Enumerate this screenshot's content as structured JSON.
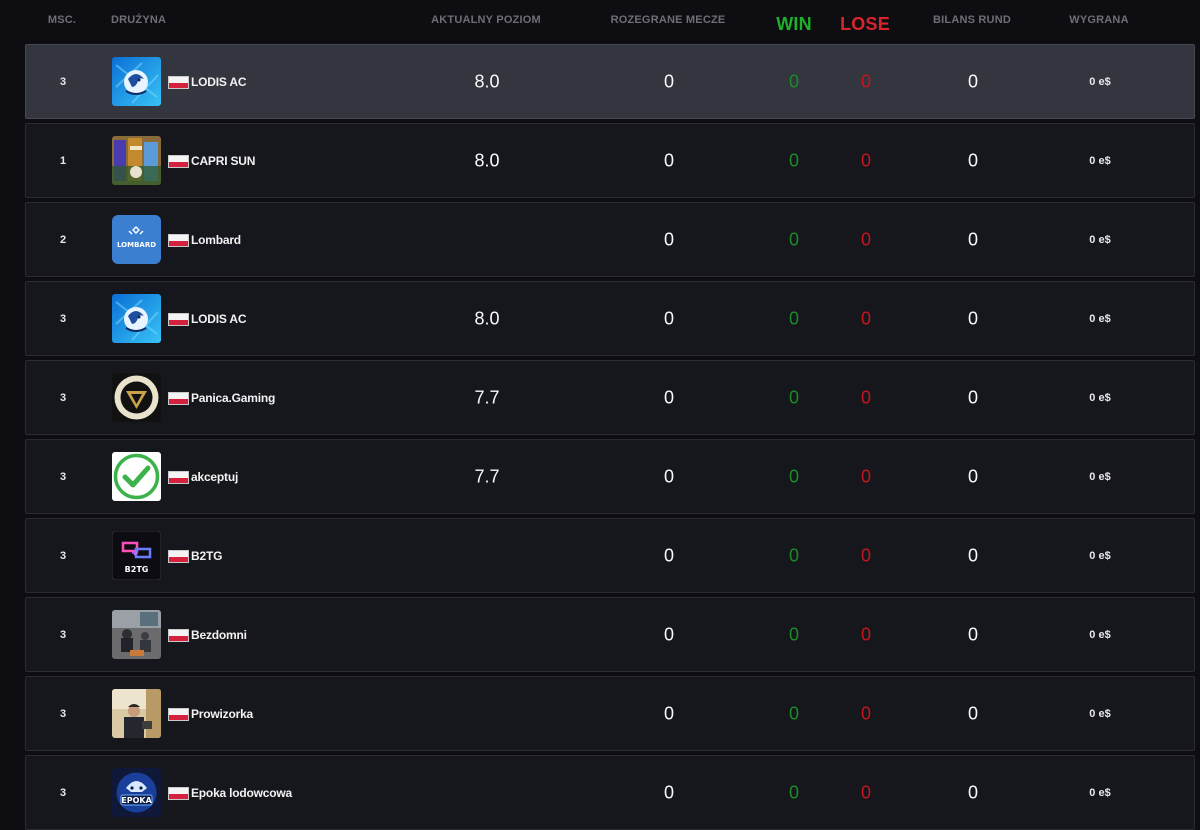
{
  "header": {
    "pos": "MSC.",
    "team": "DRUŻYNA",
    "level": "AKTUALNY POZIOM",
    "matches": "ROZEGRANE MECZE",
    "win": "WIN",
    "lose": "LOSE",
    "bilans": "BILANS RUND",
    "prize": "WYGRANA"
  },
  "colors": {
    "win": "#1fb12c",
    "lose": "#d8252b",
    "highlight_row": "#33363f",
    "row": "#16161d"
  },
  "rows": [
    {
      "pos": "3",
      "team": "LODIS AC",
      "logo": "lodis-logo",
      "flag": "poland-flag",
      "level": "8.0",
      "matches": "0",
      "win": "0",
      "lose": "0",
      "bilans": "0",
      "prize": "0 e$",
      "highlighted": true
    },
    {
      "pos": "1",
      "team": "CAPRI SUN",
      "logo": "capri-sun-logo",
      "flag": "poland-flag",
      "level": "8.0",
      "matches": "0",
      "win": "0",
      "lose": "0",
      "bilans": "0",
      "prize": "0 e$"
    },
    {
      "pos": "2",
      "team": "Lombard",
      "logo": "lombard-logo",
      "logo_text": "LOMBARD",
      "flag": "poland-flag",
      "level": "",
      "matches": "0",
      "win": "0",
      "lose": "0",
      "bilans": "0",
      "prize": "0 e$"
    },
    {
      "pos": "3",
      "team": "LODIS AC",
      "logo": "lodis-logo",
      "flag": "poland-flag",
      "level": "8.0",
      "matches": "0",
      "win": "0",
      "lose": "0",
      "bilans": "0",
      "prize": "0 e$"
    },
    {
      "pos": "3",
      "team": "Panica.Gaming",
      "logo": "panica-gaming-logo",
      "flag": "poland-flag",
      "level": "7.7",
      "matches": "0",
      "win": "0",
      "lose": "0",
      "bilans": "0",
      "prize": "0 e$"
    },
    {
      "pos": "3",
      "team": "akceptuj",
      "logo": "checkmark-logo",
      "flag": "poland-flag",
      "level": "7.7",
      "matches": "0",
      "win": "0",
      "lose": "0",
      "bilans": "0",
      "prize": "0 e$"
    },
    {
      "pos": "3",
      "team": "B2TG",
      "logo": "b2tg-logo",
      "logo_text": "B2TG",
      "flag": "poland-flag",
      "level": "",
      "matches": "0",
      "win": "0",
      "lose": "0",
      "bilans": "0",
      "prize": "0 e$"
    },
    {
      "pos": "3",
      "team": "Bezdomni",
      "logo": "bezdomni-photo",
      "flag": "poland-flag",
      "level": "",
      "matches": "0",
      "win": "0",
      "lose": "0",
      "bilans": "0",
      "prize": "0 e$"
    },
    {
      "pos": "3",
      "team": "Prowizorka",
      "logo": "prowizorka-photo",
      "flag": "poland-flag",
      "level": "",
      "matches": "0",
      "win": "0",
      "lose": "0",
      "bilans": "0",
      "prize": "0 e$"
    },
    {
      "pos": "3",
      "team": "Epoka lodowcowa",
      "logo": "epoka-logo",
      "logo_text": "EPOKA",
      "flag": "poland-flag",
      "level": "",
      "matches": "0",
      "win": "0",
      "lose": "0",
      "bilans": "0",
      "prize": "0 e$"
    }
  ]
}
